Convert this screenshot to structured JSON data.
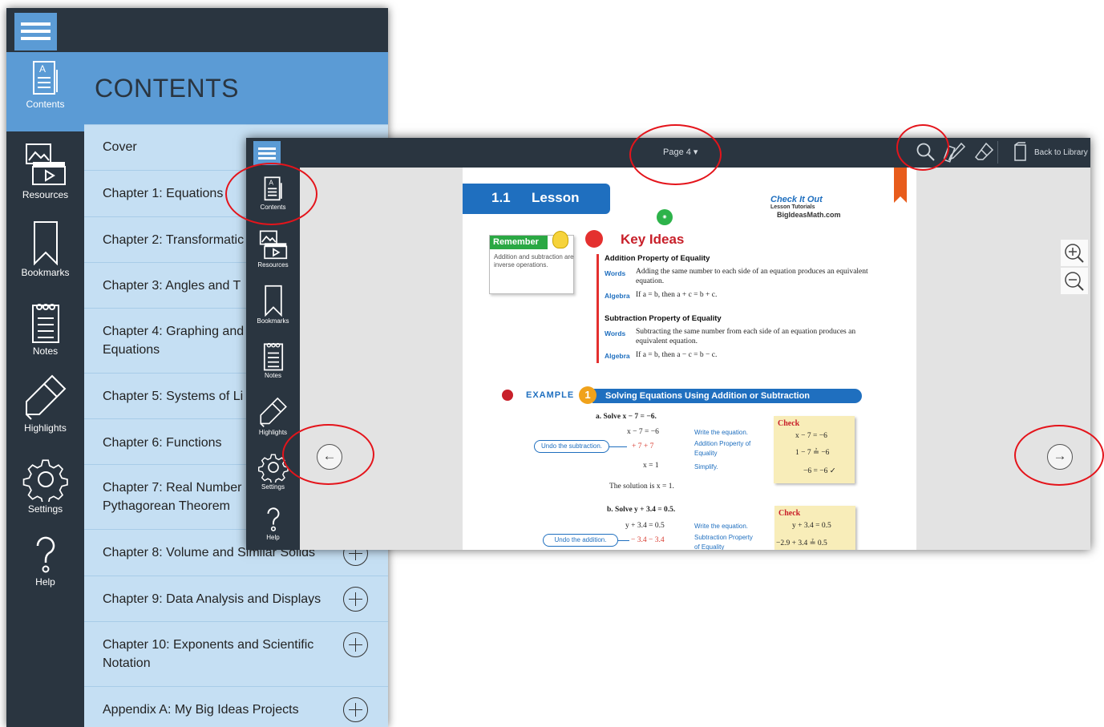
{
  "back_panel": {
    "menu_icon": "hamburger-menu-icon",
    "header_title": "CONTENTS",
    "rail": [
      {
        "label": "Contents",
        "icon": "contents-icon"
      },
      {
        "label": "Resources",
        "icon": "resources-icon"
      },
      {
        "label": "Bookmarks",
        "icon": "bookmark-icon"
      },
      {
        "label": "Notes",
        "icon": "notes-icon"
      },
      {
        "label": "Highlights",
        "icon": "highlighter-icon"
      },
      {
        "label": "Settings",
        "icon": "gear-icon"
      },
      {
        "label": "Help",
        "icon": "help-icon"
      }
    ],
    "toc": [
      {
        "label": "Cover"
      },
      {
        "label": "Chapter 1: Equations"
      },
      {
        "label": "Chapter 2: Transformatic"
      },
      {
        "label": "Chapter 3: Angles and T"
      },
      {
        "label": "Chapter 4: Graphing and",
        "label2": "Equations"
      },
      {
        "label": "Chapter 5: Systems of Li"
      },
      {
        "label": "Chapter 6: Functions"
      },
      {
        "label": "Chapter 7: Real Number",
        "label2": "Pythagorean Theorem"
      },
      {
        "label": "Chapter 8: Volume and Similar Solids"
      },
      {
        "label": "Chapter 9: Data Analysis and Displays"
      },
      {
        "label": "Chapter 10: Exponents and Scientific",
        "label2": "Notation"
      },
      {
        "label": "Appendix A: My Big Ideas Projects"
      }
    ]
  },
  "front_panel": {
    "page_indicator": "Page 4",
    "page_indicator_icon": "chevron-down-icon",
    "back_to_library": "Back to Library",
    "tools": [
      "search-icon",
      "pencil-ruler-icon",
      "eraser-icon",
      "library-book-icon"
    ],
    "rail": [
      {
        "label": "Contents"
      },
      {
        "label": "Resources"
      },
      {
        "label": "Bookmarks"
      },
      {
        "label": "Notes"
      },
      {
        "label": "Highlights"
      },
      {
        "label": "Settings"
      },
      {
        "label": "Help"
      }
    ],
    "nav_prev": "←",
    "nav_next": "→",
    "zoom_in": "zoom-in-icon",
    "zoom_out": "zoom-out-icon"
  },
  "page": {
    "lesson_number": "1.1",
    "lesson_word": "Lesson",
    "check_it_out": "Check It Out",
    "lesson_tutorials": "Lesson Tutorials",
    "site": "BigIdeasMath.com",
    "remember_title": "Remember",
    "remember_body": "Addition and subtraction are inverse operations.",
    "key_ideas": "Key Ideas",
    "add_prop_title": "Addition Property of Equality",
    "words_label": "Words",
    "algebra_label": "Algebra",
    "add_words": "Adding the same number to each side of an equation produces an equivalent equation.",
    "add_algebra": "If a = b, then a + c = b + c.",
    "sub_prop_title": "Subtraction Property of Equality",
    "sub_words": "Subtracting the same number from each side of an equation produces an equivalent equation.",
    "sub_algebra": "If a = b, then a − c = b − c.",
    "example_word": "EXAMPLE",
    "example_number": "1",
    "example_title": "Solving Equations Using Addition or Subtraction",
    "part_a": "a. Solve  x − 7 = −6.",
    "a_line1": "x − 7 = −6",
    "a_line2": "+ 7    + 7",
    "a_line3": "x =    1",
    "undo_sub": "Undo the subtraction.",
    "write_eq": "Write the equation.",
    "add_prop_note": "Addition Property of Equality",
    "simplify": "Simplify.",
    "solution_a": "The solution is  x = 1.",
    "check": "Check",
    "check_a1": "x − 7 = −6",
    "check_a2": "1 − 7 ≟ −6",
    "check_a3": "−6 = −6 ✓",
    "part_b": "b. Solve  y + 3.4 = 0.5.",
    "b_line1": "y + 3.4 =    0.5",
    "b_line2": "− 3.4     − 3.4",
    "undo_add": "Undo the addition.",
    "sub_prop_note": "Subtraction Property of Equality",
    "check_b1": "y + 3.4 = 0.5",
    "check_b2": "−2.9 + 3.4 ≟ 0.5"
  }
}
